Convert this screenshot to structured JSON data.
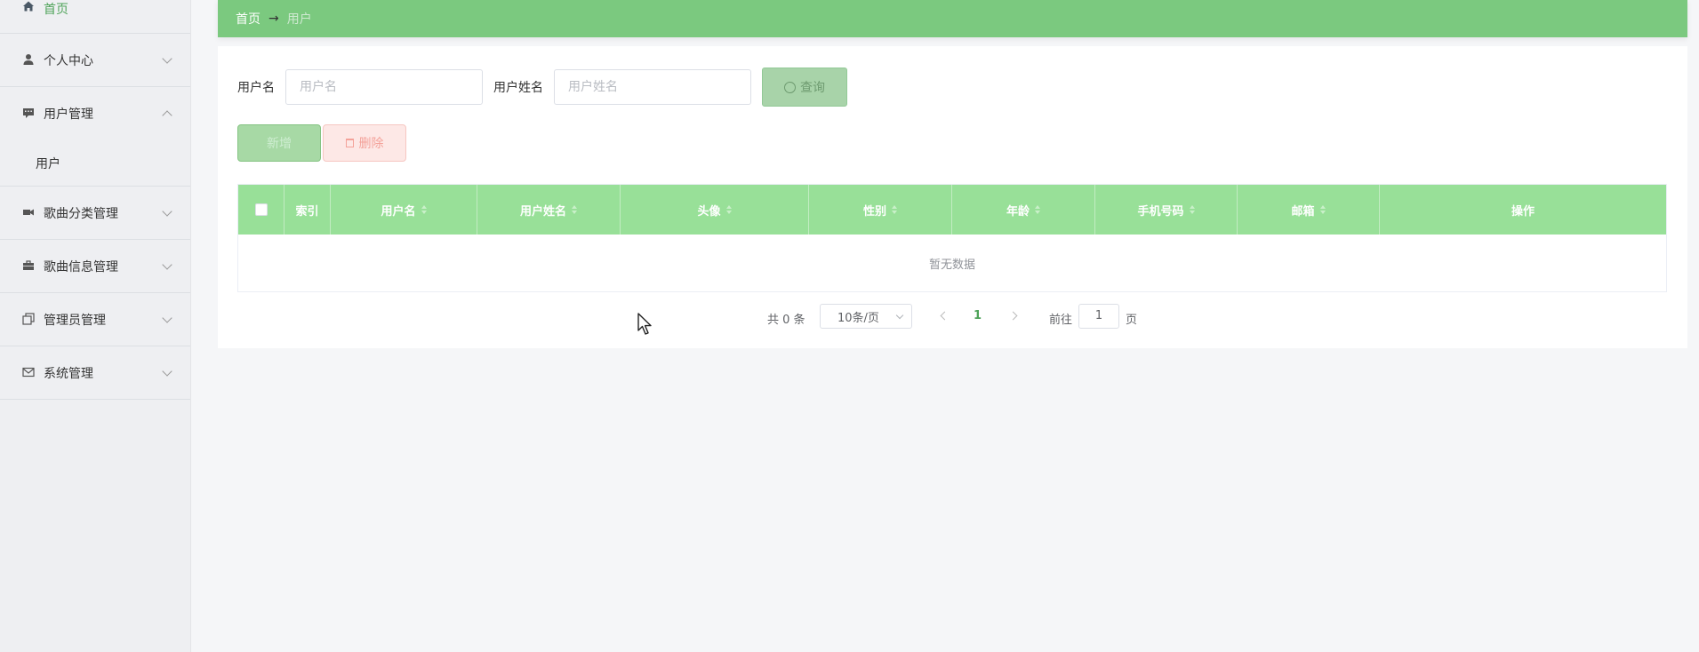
{
  "sidebar": {
    "items": [
      {
        "label": "首页",
        "icon": "home-icon"
      },
      {
        "label": "个人中心",
        "icon": "user-icon"
      },
      {
        "label": "用户管理",
        "icon": "message-icon",
        "expanded": true,
        "children": [
          {
            "label": "用户"
          }
        ]
      },
      {
        "label": "歌曲分类管理",
        "icon": "video-icon"
      },
      {
        "label": "歌曲信息管理",
        "icon": "briefcase-icon"
      },
      {
        "label": "管理员管理",
        "icon": "copy-icon"
      },
      {
        "label": "系统管理",
        "icon": "mail-icon"
      }
    ]
  },
  "breadcrumb": {
    "home": "首页",
    "separator": "→",
    "current": "用户"
  },
  "search": {
    "username_label": "用户名",
    "username_placeholder": "用户名",
    "realname_label": "用户姓名",
    "realname_placeholder": "用户姓名",
    "query_label": "查询"
  },
  "actions": {
    "add_label": "新增",
    "delete_label": "删除"
  },
  "table": {
    "columns": [
      "索引",
      "用户名",
      "用户姓名",
      "头像",
      "性别",
      "年龄",
      "手机号码",
      "邮箱",
      "操作"
    ],
    "empty_text": "暂无数据"
  },
  "pagination": {
    "total_text": "共 0 条",
    "page_size": "10条/页",
    "current_page": "1",
    "goto_label": "前往",
    "goto_value": "1",
    "page_unit": "页"
  },
  "colors": {
    "accent": "#7bc97f",
    "header": "#98e098",
    "danger": "#f4a29a"
  }
}
